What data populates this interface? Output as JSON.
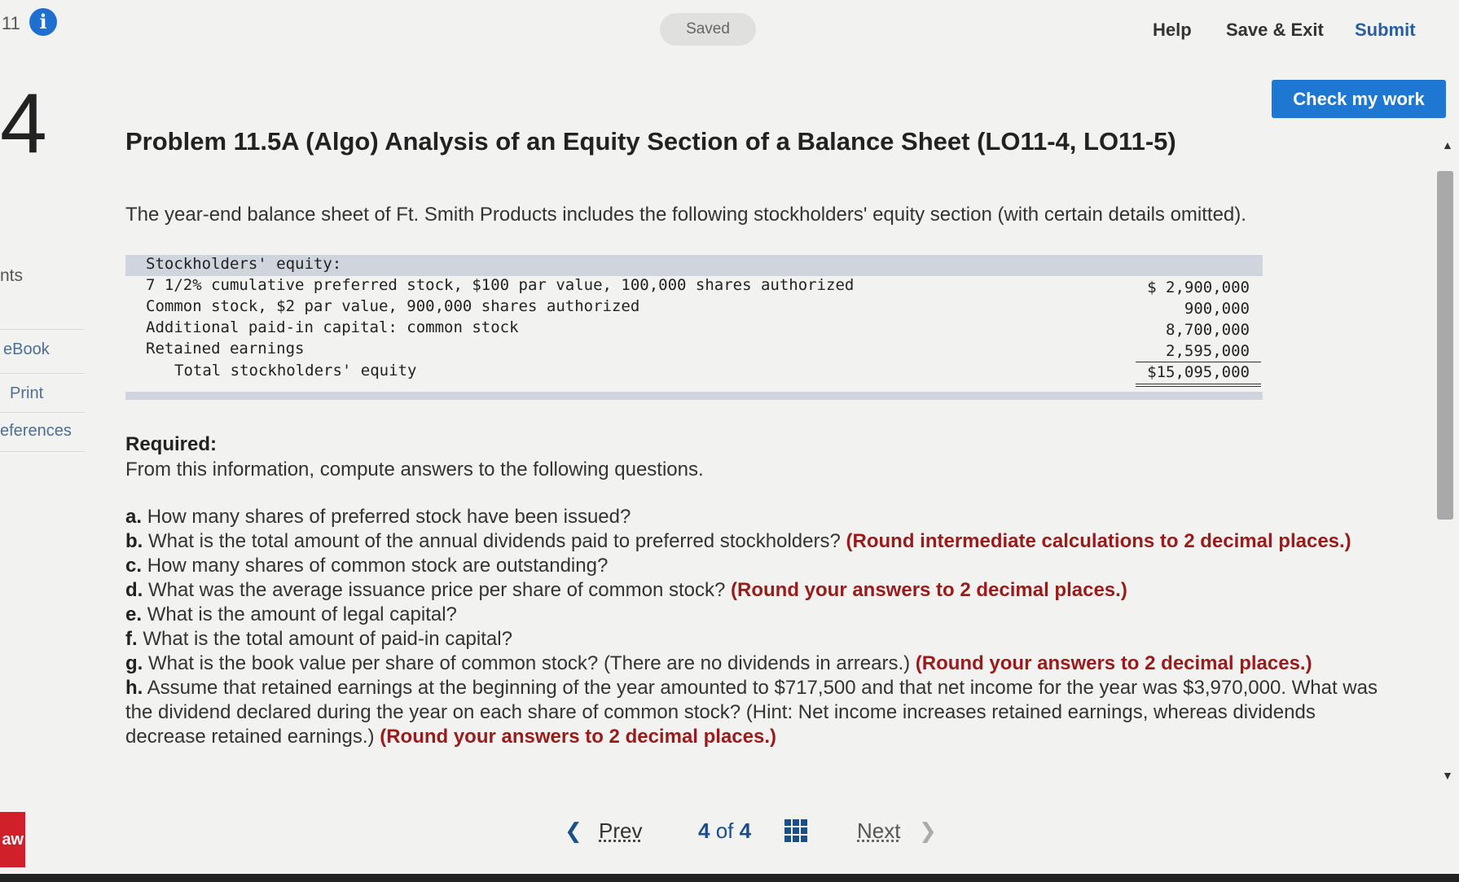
{
  "header": {
    "question_number": "11",
    "saved_label": "Saved",
    "help_label": "Help",
    "save_exit_label": "Save & Exit",
    "submit_label": "Submit",
    "check_work_label": "Check my work"
  },
  "left_rail": {
    "question_big_number": "4",
    "partial_label": "nts",
    "items": [
      {
        "label": "eBook"
      },
      {
        "label": "Print"
      },
      {
        "label": "eferences"
      }
    ],
    "brand_text": "aw"
  },
  "problem": {
    "title": "Problem 11.5A (Algo) Analysis of an Equity Section of a Balance Sheet (LO11-4, LO11-5)",
    "intro": "The year-end balance sheet of Ft. Smith Products includes the following stockholders' equity section (with certain details omitted)."
  },
  "equity_section": {
    "heading": "Stockholders' equity:",
    "rows": [
      {
        "label": "7 1/2% cumulative preferred stock, $100 par value, 100,000 shares authorized",
        "value": "$ 2,900,000"
      },
      {
        "label": "Common stock, $2 par value, 900,000 shares authorized",
        "value": "900,000"
      },
      {
        "label": "Additional paid-in capital: common stock",
        "value": "8,700,000"
      },
      {
        "label": "Retained earnings",
        "value": "2,595,000"
      },
      {
        "label": "Total stockholders' equity",
        "value": "$15,095,000"
      }
    ]
  },
  "required": {
    "heading": "Required:",
    "subheading": "From this information, compute answers to the following questions.",
    "questions": [
      {
        "letter": "a.",
        "text": "How many shares of preferred stock have been issued?",
        "note": ""
      },
      {
        "letter": "b.",
        "text": "What is the total amount of the annual dividends paid to preferred stockholders?",
        "note": "(Round intermediate calculations to 2 decimal places.)"
      },
      {
        "letter": "c.",
        "text": "How many shares of common stock are outstanding?",
        "note": ""
      },
      {
        "letter": "d.",
        "text": "What was the average issuance price per share of common stock?",
        "note": "(Round your answers to 2 decimal places.)"
      },
      {
        "letter": "e.",
        "text": "What is the amount of legal capital?",
        "note": ""
      },
      {
        "letter": "f.",
        "text": "What is the total amount of paid-in capital?",
        "note": ""
      },
      {
        "letter": "g.",
        "text": "What is the book value per share of common stock? (There are no dividends in arrears.)",
        "note": "(Round your answers to 2 decimal places.)"
      },
      {
        "letter": "h.",
        "text": "Assume that retained earnings at the beginning of the year amounted to $717,500 and that net income for the year was $3,970,000. What was the dividend declared during the year on each share of common stock? (Hint: Net income increases retained earnings, whereas dividends decrease retained earnings.)",
        "note": "(Round your answers to 2 decimal places.)"
      }
    ]
  },
  "footer_nav": {
    "prev_label": "Prev",
    "current_page": "4",
    "of_label": "of",
    "total_pages": "4",
    "next_label": "Next"
  },
  "colors": {
    "accent_blue": "#1e78d2",
    "note_red": "#9a1b1b",
    "table_band": "#cfd4dd"
  },
  "icons": [
    "info-icon",
    "chevron-left-icon",
    "grid-icon",
    "chevron-right-icon",
    "scroll-up-arrow-icon",
    "scroll-down-arrow-icon"
  ]
}
